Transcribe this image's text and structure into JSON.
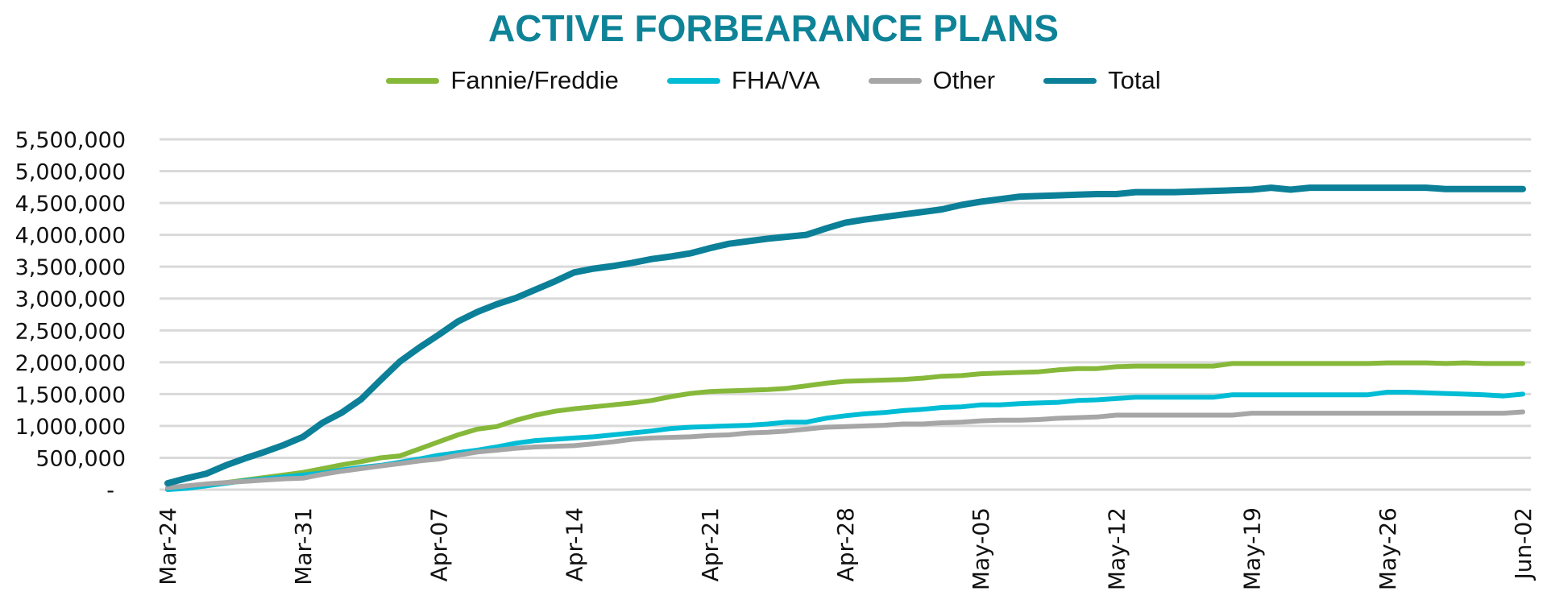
{
  "chart_data": {
    "type": "line",
    "title": "ACTIVE FORBEARANCE PLANS",
    "xlabel": "",
    "ylabel": "",
    "ylim": [
      0,
      5500000
    ],
    "yticks": [
      0,
      500000,
      1000000,
      1500000,
      2000000,
      2500000,
      3000000,
      3500000,
      4000000,
      4500000,
      5000000,
      5500000
    ],
    "ytick_labels": [
      "-",
      "500,000",
      "1,000,000",
      "1,500,000",
      "2,000,000",
      "2,500,000",
      "3,000,000",
      "3,500,000",
      "4,000,000",
      "4,500,000",
      "5,000,000",
      "5,500,000"
    ],
    "x_start": "Mar-24",
    "x_end": "Jun-02",
    "x_step_days": 1,
    "xtick_labels": [
      "Mar-24",
      "Mar-31",
      "Apr-07",
      "Apr-14",
      "Apr-21",
      "Apr-28",
      "May-05",
      "May-12",
      "May-19",
      "May-26",
      "Jun-02"
    ],
    "xtick_interval_days": 7,
    "grid": true,
    "legend_position": "top-center",
    "series": [
      {
        "name": "Fannie/Freddie",
        "color": "#86b83a",
        "values": [
          20000,
          50000,
          80000,
          110000,
          150000,
          190000,
          230000,
          270000,
          330000,
          390000,
          440000,
          500000,
          530000,
          640000,
          750000,
          860000,
          950000,
          990000,
          1090000,
          1170000,
          1230000,
          1270000,
          1300000,
          1330000,
          1360000,
          1400000,
          1460000,
          1510000,
          1540000,
          1550000,
          1560000,
          1570000,
          1590000,
          1630000,
          1670000,
          1700000,
          1710000,
          1720000,
          1730000,
          1750000,
          1780000,
          1790000,
          1820000,
          1830000,
          1840000,
          1850000,
          1880000,
          1900000,
          1900000,
          1930000,
          1940000,
          1940000,
          1940000,
          1940000,
          1940000,
          1980000,
          1980000,
          1980000,
          1980000,
          1980000,
          1980000,
          1980000,
          1980000,
          1990000,
          1990000,
          1990000,
          1980000,
          1990000,
          1980000,
          1980000,
          1980000
        ]
      },
      {
        "name": "FHA/VA",
        "color": "#00bcd4",
        "values": [
          0,
          20000,
          60000,
          100000,
          140000,
          170000,
          200000,
          230000,
          260000,
          310000,
          350000,
          380000,
          430000,
          480000,
          540000,
          580000,
          620000,
          670000,
          730000,
          770000,
          790000,
          810000,
          830000,
          860000,
          890000,
          920000,
          960000,
          980000,
          990000,
          1000000,
          1010000,
          1030000,
          1060000,
          1060000,
          1120000,
          1160000,
          1190000,
          1210000,
          1240000,
          1260000,
          1290000,
          1300000,
          1330000,
          1330000,
          1350000,
          1360000,
          1370000,
          1400000,
          1410000,
          1430000,
          1450000,
          1450000,
          1450000,
          1450000,
          1450000,
          1490000,
          1490000,
          1490000,
          1490000,
          1490000,
          1490000,
          1490000,
          1490000,
          1530000,
          1530000,
          1520000,
          1510000,
          1500000,
          1490000,
          1470000,
          1500000
        ]
      },
      {
        "name": "Other",
        "color": "#a6a6a6",
        "values": [
          30000,
          60000,
          90000,
          110000,
          130000,
          150000,
          170000,
          180000,
          240000,
          290000,
          330000,
          370000,
          410000,
          450000,
          480000,
          540000,
          590000,
          620000,
          650000,
          670000,
          680000,
          690000,
          720000,
          750000,
          790000,
          810000,
          820000,
          830000,
          850000,
          860000,
          890000,
          900000,
          920000,
          950000,
          980000,
          990000,
          1000000,
          1010000,
          1030000,
          1030000,
          1050000,
          1060000,
          1080000,
          1090000,
          1090000,
          1100000,
          1120000,
          1130000,
          1140000,
          1170000,
          1170000,
          1170000,
          1170000,
          1170000,
          1170000,
          1170000,
          1200000,
          1200000,
          1200000,
          1200000,
          1200000,
          1200000,
          1200000,
          1200000,
          1200000,
          1200000,
          1200000,
          1200000,
          1200000,
          1200000,
          1220000
        ]
      },
      {
        "name": "Total",
        "color": "#0b8098",
        "values": [
          100000,
          180000,
          250000,
          380000,
          490000,
          590000,
          700000,
          830000,
          1050000,
          1210000,
          1420000,
          1720000,
          2010000,
          2230000,
          2430000,
          2640000,
          2790000,
          2910000,
          3010000,
          3140000,
          3270000,
          3410000,
          3470000,
          3510000,
          3560000,
          3620000,
          3660000,
          3710000,
          3790000,
          3860000,
          3900000,
          3940000,
          3970000,
          4000000,
          4100000,
          4190000,
          4240000,
          4280000,
          4320000,
          4360000,
          4400000,
          4470000,
          4520000,
          4560000,
          4600000,
          4610000,
          4620000,
          4630000,
          4640000,
          4640000,
          4670000,
          4670000,
          4670000,
          4680000,
          4690000,
          4700000,
          4710000,
          4740000,
          4710000,
          4740000,
          4740000,
          4740000,
          4740000,
          4740000,
          4740000,
          4740000,
          4720000,
          4720000,
          4720000,
          4720000,
          4720000
        ]
      }
    ]
  }
}
